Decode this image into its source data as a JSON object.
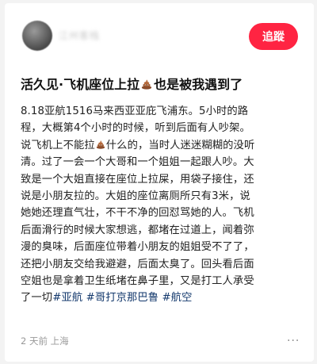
{
  "header": {
    "username": "江州客栈",
    "follow_label": "追蹤"
  },
  "post": {
    "title_before": "活久见·飞机座位上拉",
    "title_after": "也是被我遇到了",
    "lines": [
      [
        "8.18亚航1516马来西亚亚庇飞浦东。5小时的路"
      ],
      [
        "程，大概第4个小时的时候，听到后面有人吵架。"
      ],
      [
        "说飞机上不能拉",
        "什么的，当时人迷迷糊糊的没听"
      ],
      [
        "清。过了一会一个大哥和一个姐姐一起跟人吵。大"
      ],
      [
        "致是一个大姐直接在座位上拉屎，用袋子接住，还"
      ],
      [
        "说是小朋友拉的。大姐的座位离厕所只有3米，说"
      ],
      [
        "她她还理直气壮，不干不净的回怼骂她的人。飞机"
      ],
      [
        "后面滑行的时候大家想逃，都堵在过道上，闻着弥"
      ],
      [
        "漫的臭味，后面座位带着小朋友的姐姐受不了了，"
      ],
      [
        "还把小朋友交给我避避，后面太臭了。回头看后面"
      ],
      [
        "空姐也是拿着卫生纸堵在鼻子里，又是打工人承受"
      ]
    ],
    "last_line_text": "了一切",
    "tags": [
      "#亚航",
      "#哥打京那巴鲁",
      "#航空"
    ]
  },
  "meta": {
    "time": "2 天前",
    "location": "上海",
    "more_label": "···"
  },
  "icons": {
    "poop": "poop-emoji-icon",
    "more": "more-dots-icon"
  },
  "colors": {
    "accent": "#ff2442",
    "tag": "#13386c"
  }
}
